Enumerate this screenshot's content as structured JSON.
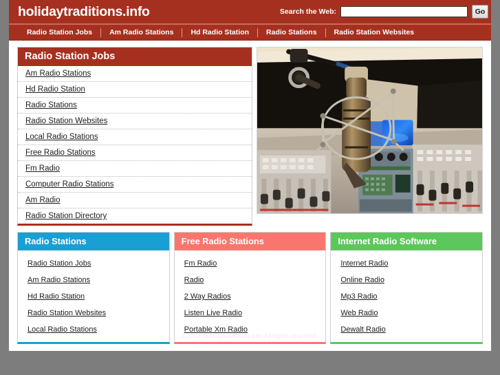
{
  "site": {
    "brand": "holidaytraditions.info",
    "accent_red": "#a6301f",
    "accent_blue": "#1a9fd4",
    "accent_salmon": "#f8766d",
    "accent_green": "#5cc75c"
  },
  "search": {
    "label": "Search the Web:",
    "value": "",
    "placeholder": "",
    "button": "Go"
  },
  "nav": {
    "items": [
      {
        "label": "Radio Station Jobs"
      },
      {
        "label": "Am Radio Stations"
      },
      {
        "label": "Hd Radio Station"
      },
      {
        "label": "Radio Stations"
      },
      {
        "label": "Radio Station Websites"
      }
    ]
  },
  "main_panel": {
    "title": "Radio Station Jobs",
    "links": [
      {
        "label": "Am Radio Stations"
      },
      {
        "label": "Hd Radio Station"
      },
      {
        "label": "Radio Stations"
      },
      {
        "label": "Radio Station Websites"
      },
      {
        "label": "Local Radio Stations"
      },
      {
        "label": "Free Radio Stations"
      },
      {
        "label": "Fm Radio"
      },
      {
        "label": "Computer Radio Stations"
      },
      {
        "label": "Am Radio"
      },
      {
        "label": "Radio Station Directory"
      }
    ]
  },
  "hero_image": {
    "alt": "studio microphone on mixing console",
    "name": "radio-studio-photo"
  },
  "boxes": [
    {
      "title": "Radio Stations",
      "color": "#1a9fd4",
      "links": [
        {
          "label": "Radio Station Jobs"
        },
        {
          "label": "Am Radio Stations"
        },
        {
          "label": "Hd Radio Station"
        },
        {
          "label": "Radio Station Websites"
        },
        {
          "label": "Local Radio Stations"
        }
      ]
    },
    {
      "title": "Free Radio Stations",
      "color": "#f8766d",
      "links": [
        {
          "label": "Fm Radio"
        },
        {
          "label": "Radio"
        },
        {
          "label": "2 Way Radios"
        },
        {
          "label": "Listen Live Radio"
        },
        {
          "label": "Portable Xm Radio"
        }
      ]
    },
    {
      "title": "Internet Radio Software",
      "color": "#5cc75c",
      "links": [
        {
          "label": "Internet Radio"
        },
        {
          "label": "Online Radio"
        },
        {
          "label": "Mp3 Radio"
        },
        {
          "label": "Web Radio"
        },
        {
          "label": "Dewalt Radio"
        }
      ]
    }
  ],
  "footer": {
    "copyright": "©2011 holidaytraditions.info All rights reserved."
  }
}
